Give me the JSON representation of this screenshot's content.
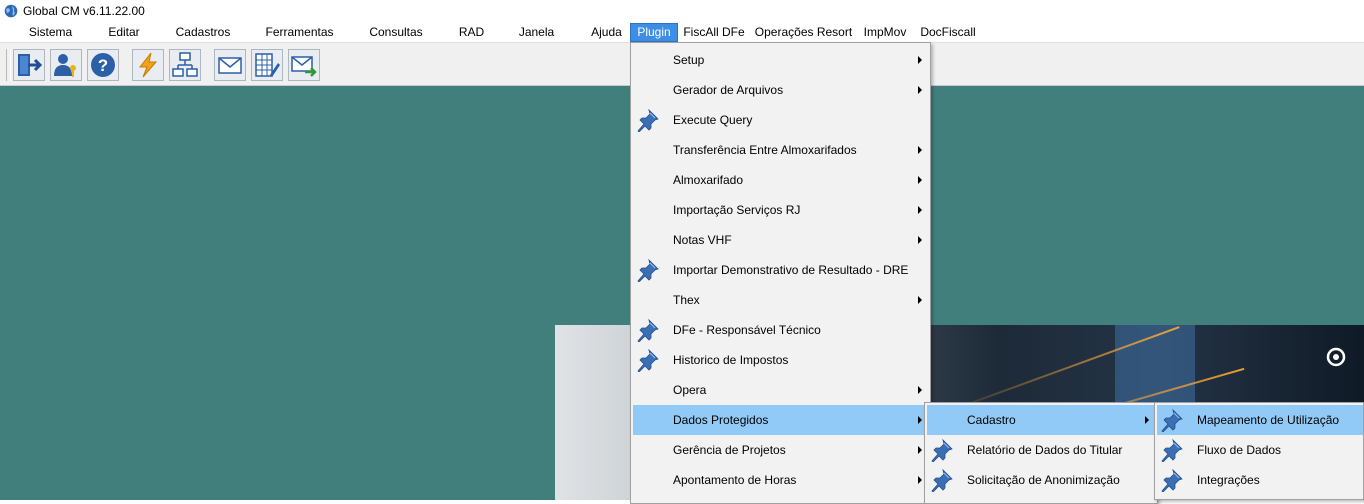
{
  "window": {
    "title": "Global CM v6.11.22.00"
  },
  "menubar": {
    "items": [
      {
        "label": "Sistema"
      },
      {
        "label": "Editar"
      },
      {
        "label": "Cadastros"
      },
      {
        "label": "Ferramentas"
      },
      {
        "label": "Consultas"
      },
      {
        "label": "RAD"
      },
      {
        "label": "Janela"
      },
      {
        "label": "Ajuda"
      },
      {
        "label": "Plugin"
      },
      {
        "label": "FiscAll DFe"
      },
      {
        "label": "Operações Resort"
      },
      {
        "label": "ImpMov"
      },
      {
        "label": "DocFiscall"
      }
    ],
    "active": "Plugin"
  },
  "toolbar": {
    "buttons": [
      {
        "icon": "exit-door-icon"
      },
      {
        "icon": "user-key-icon"
      },
      {
        "icon": "help-question-icon"
      },
      {
        "icon": "lightning-icon"
      },
      {
        "icon": "org-chart-icon"
      },
      {
        "icon": "envelope-icon"
      },
      {
        "icon": "spreadsheet-pen-icon"
      },
      {
        "icon": "envelope-send-icon"
      }
    ]
  },
  "plugin_menu": {
    "items": [
      {
        "label": "Setup",
        "submenu": true,
        "pin": false
      },
      {
        "label": "Gerador de Arquivos",
        "submenu": true,
        "pin": false
      },
      {
        "label": "Execute Query",
        "submenu": false,
        "pin": true
      },
      {
        "label": "Transferência Entre Almoxarifados",
        "submenu": true,
        "pin": false
      },
      {
        "label": "Almoxarifado",
        "submenu": true,
        "pin": false
      },
      {
        "label": "Importação Serviços RJ",
        "submenu": true,
        "pin": false
      },
      {
        "label": "Notas VHF",
        "submenu": true,
        "pin": false
      },
      {
        "label": "Importar Demonstrativo de Resultado - DRE",
        "submenu": false,
        "pin": true
      },
      {
        "label": "Thex",
        "submenu": true,
        "pin": false
      },
      {
        "label": "DFe - Responsável Técnico",
        "submenu": false,
        "pin": true
      },
      {
        "label": "Historico de Impostos",
        "submenu": false,
        "pin": true
      },
      {
        "label": "Opera",
        "submenu": true,
        "pin": false
      },
      {
        "label": "Dados Protegidos",
        "submenu": true,
        "pin": false,
        "highlighted": true
      },
      {
        "label": "Gerência de Projetos",
        "submenu": true,
        "pin": false
      },
      {
        "label": "Apontamento de Horas",
        "submenu": true,
        "pin": false
      }
    ]
  },
  "dados_protegidos_menu": {
    "items": [
      {
        "label": "Cadastro",
        "submenu": true,
        "pin": false,
        "highlighted": true
      },
      {
        "label": "Relatório de Dados do Titular",
        "submenu": false,
        "pin": true
      },
      {
        "label": "Solicitação de Anonimização",
        "submenu": false,
        "pin": true
      }
    ]
  },
  "cadastro_menu": {
    "items": [
      {
        "label": "Mapeamento de Utilização",
        "pin": true,
        "highlighted": true
      },
      {
        "label": "Fluxo de Dados",
        "pin": true
      },
      {
        "label": "Integrações",
        "pin": true
      }
    ]
  },
  "colors": {
    "desktop": "#417f7d",
    "menu_bg": "#f2f2f2",
    "menu_highlight": "#91c9f7",
    "menubar_active": "#3d8ee4"
  }
}
